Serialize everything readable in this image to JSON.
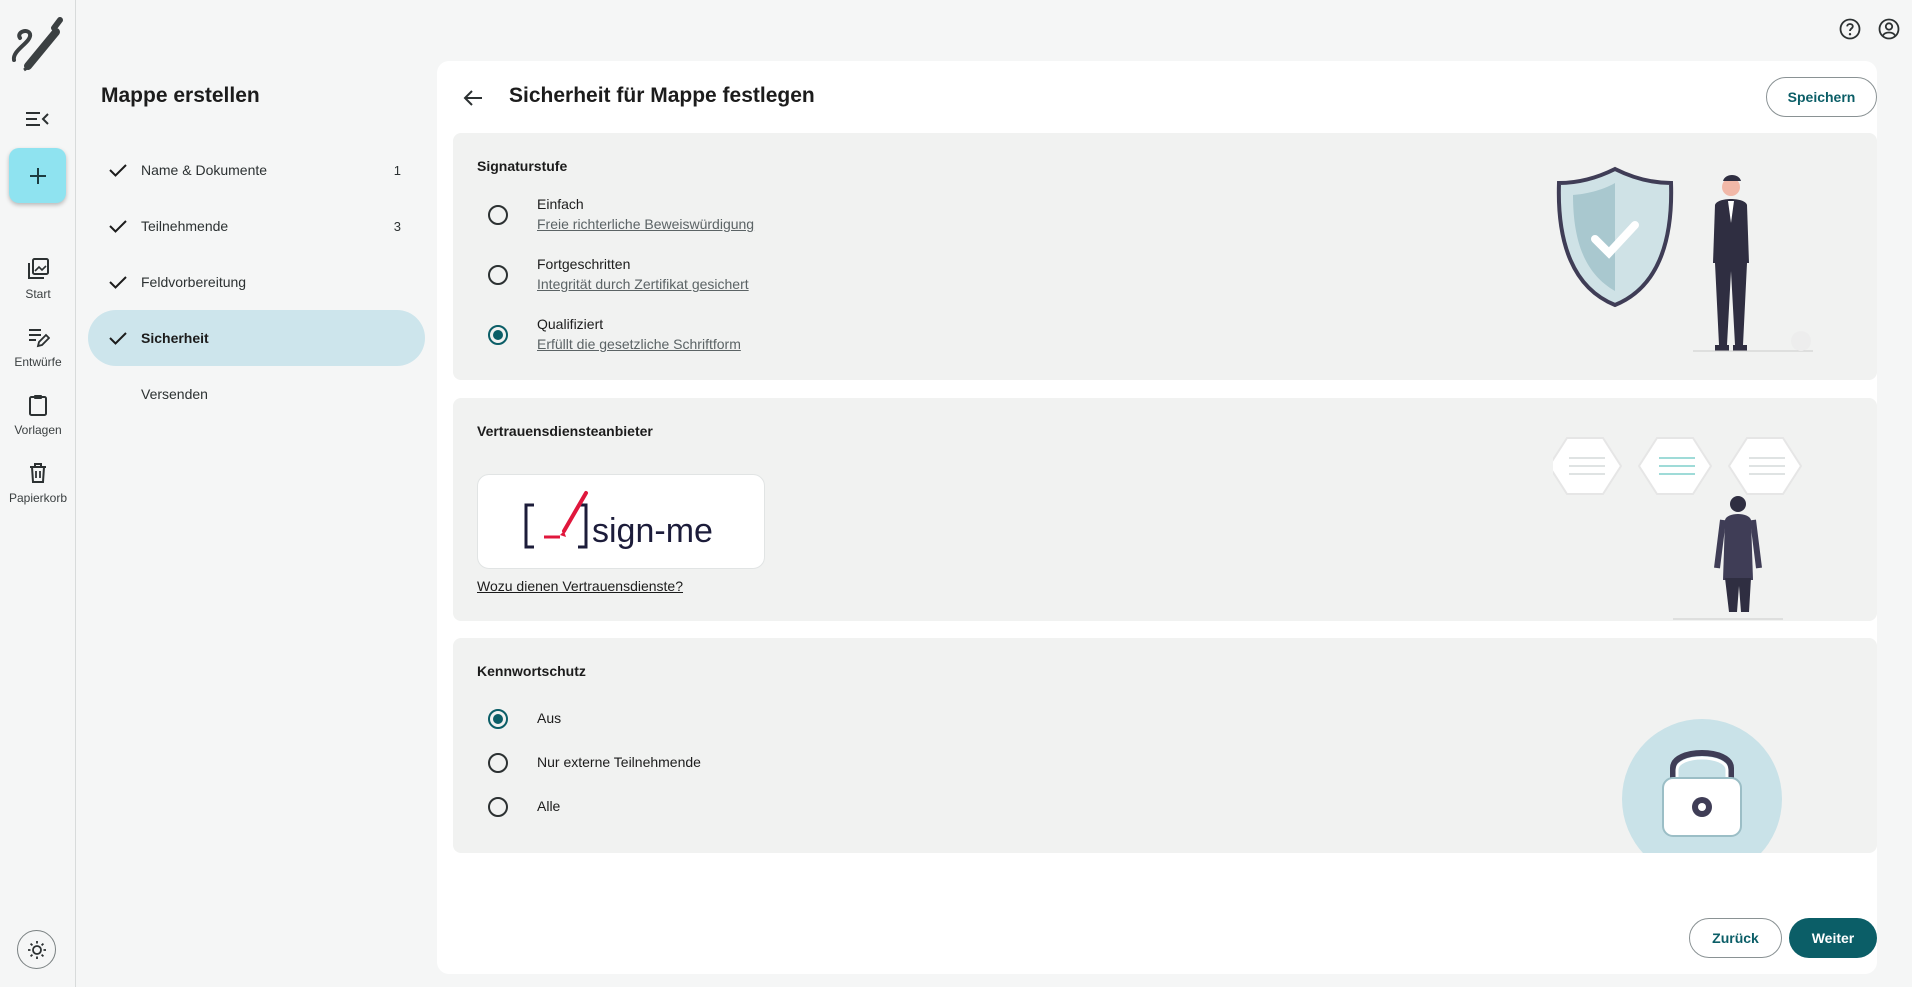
{
  "rail": {
    "items": [
      {
        "label": "Start"
      },
      {
        "label": "Entwürfe"
      },
      {
        "label": "Vorlagen"
      },
      {
        "label": "Papierkorb"
      }
    ]
  },
  "stepper": {
    "title": "Mappe erstellen",
    "steps": [
      {
        "label": "Name & Dokumente",
        "count": "1",
        "done": true
      },
      {
        "label": "Teilnehmende",
        "count": "3",
        "done": true
      },
      {
        "label": "Feldvorbereitung",
        "count": "",
        "done": true
      },
      {
        "label": "Sicherheit",
        "count": "",
        "done": true,
        "active": true
      },
      {
        "label": "Versenden",
        "count": "",
        "done": false
      }
    ]
  },
  "header": {
    "title": "Sicherheit für Mappe festlegen",
    "save_label": "Speichern"
  },
  "signature": {
    "title": "Signaturstufe",
    "options": [
      {
        "label": "Einfach",
        "sub": "Freie richterliche Beweiswürdigung",
        "selected": false
      },
      {
        "label": "Fortgeschritten",
        "sub": "Integrität durch Zertifikat gesichert",
        "selected": false
      },
      {
        "label": "Qualifiziert",
        "sub": "Erfüllt die gesetzliche Schriftform",
        "selected": true
      }
    ]
  },
  "trust": {
    "title": "Vertrauensdiensteanbieter",
    "provider_name": "sign-me",
    "help_link": "Wozu dienen Vertrauensdienste?"
  },
  "password": {
    "title": "Kennwortschutz",
    "options": [
      {
        "label": "Aus",
        "selected": true
      },
      {
        "label": "Nur externe Teilnehmende",
        "selected": false
      },
      {
        "label": "Alle",
        "selected": false
      }
    ]
  },
  "footer": {
    "back_label": "Zurück",
    "next_label": "Weiter"
  },
  "colors": {
    "primary": "#0b5e67",
    "fab": "#8fe3f0",
    "active_step": "#cde5ec",
    "section_bg": "#f1f2f1"
  }
}
